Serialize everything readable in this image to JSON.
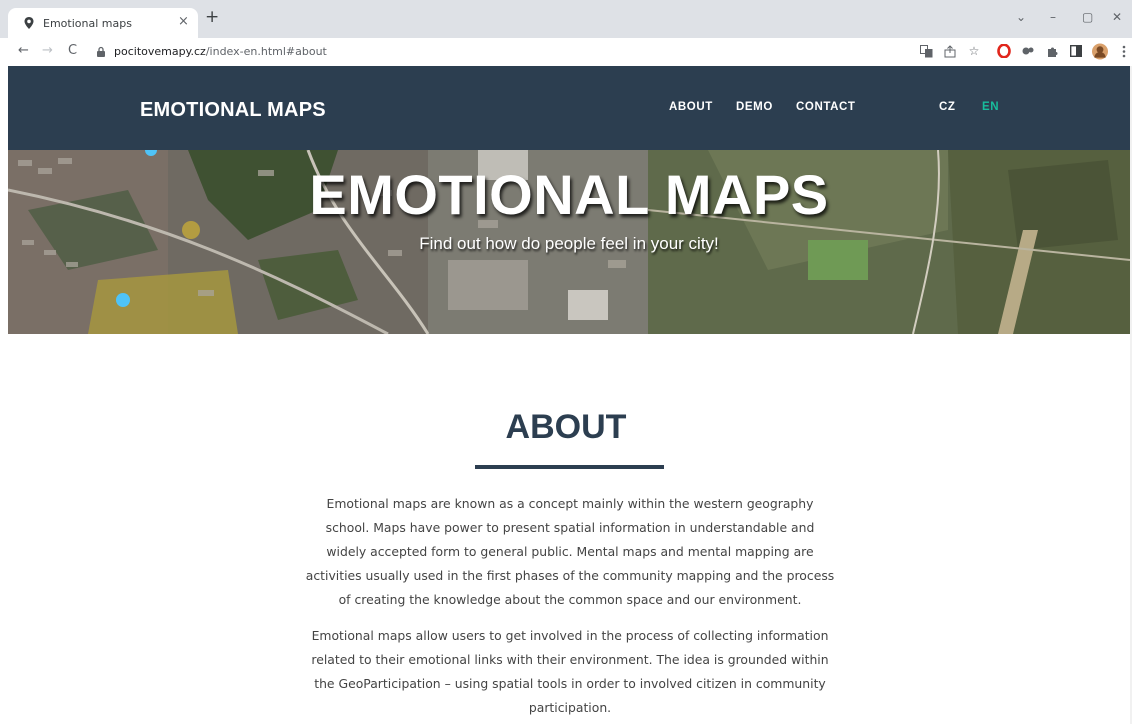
{
  "browser": {
    "tab_title": "Emotional maps",
    "tab_close": "×",
    "new_tab": "+",
    "url_host": "pocitovemapy.cz",
    "url_path": "/index-en.html#about",
    "window_controls": {
      "minimize": "–",
      "restore": "▢",
      "close": "✕",
      "chevron": "⌄"
    },
    "nav": {
      "back": "←",
      "forward": "→",
      "reload": "C"
    },
    "icons": [
      "translate-icon",
      "share-icon",
      "bookmark-star-icon",
      "opera-icon",
      "extension-icon",
      "puzzle-icon",
      "sidepanel-icon",
      "profile-avatar",
      "menu-icon"
    ]
  },
  "header": {
    "brand": "EMOTIONAL MAPS",
    "nav": [
      {
        "label": "ABOUT"
      },
      {
        "label": "DEMO"
      },
      {
        "label": "CONTACT"
      }
    ],
    "languages": [
      {
        "label": "CZ",
        "active": false
      },
      {
        "label": "EN",
        "active": true
      }
    ],
    "colors": {
      "bar": "#2c3e50",
      "active_lang": "#18bc9c",
      "text": "#ffffff"
    }
  },
  "hero": {
    "title": "EMOTIONAL MAPS",
    "subtitle": "Find out how do people feel in your city!"
  },
  "about": {
    "title": "ABOUT",
    "paragraph1_lines": [
      "Emotional maps are known as a concept mainly within the western geography",
      "school. Maps have power to present spatial information in understandable and",
      "widely accepted form to general public. Mental maps and mental mapping are",
      "activities usually used in the first phases of the community mapping and the process",
      "of creating the knowledge about the common space and our environment."
    ],
    "paragraph2_lines": [
      "Emotional maps allow users to get involved in the process of collecting information",
      "related to their emotional links with their environment. The idea is grounded within",
      "the GeoParticipation – using spatial tools in order to involved citizen in community",
      "participation."
    ]
  }
}
